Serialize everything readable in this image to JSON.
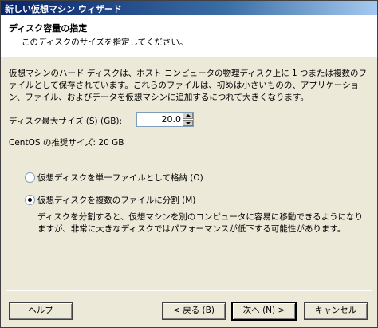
{
  "window": {
    "title": "新しい仮想マシン ウィザード"
  },
  "header": {
    "title": "ディスク容量の指定",
    "subtitle": "このディスクのサイズを指定してください。"
  },
  "description": "仮想マシンのハード ディスクは、ホスト コンピュータの物理ディスク上に 1 つまたは複数のファイルとして保存されています。これらのファイルは、初めは小さいものの、アプリケーション、ファイル、およびデータを仮想マシンに追加するにつれて大きくなります。",
  "disk_size": {
    "label": "ディスク最大サイズ (S) (GB):",
    "value": "20.0"
  },
  "recommended": "CentOS の推奨サイズ: 20 GB",
  "options": {
    "single_file_label": "仮想ディスクを単一ファイルとして格納 (O)",
    "single_file_selected": false,
    "split_label": "仮想ディスクを複数のファイルに分割 (M)",
    "split_selected": true,
    "split_description": "ディスクを分割すると、仮想マシンを別のコンピュータに容易に移動できるようになりますが、非常に大きなディスクではパフォーマンスが低下する可能性があります。"
  },
  "buttons": {
    "help": "ヘルプ",
    "back": "< 戻る (B)",
    "next": "次へ (N) >",
    "cancel": "キャンセル"
  },
  "colors": {
    "titlebar_start": "#0a246a",
    "dialog_bg": "#ece9d8",
    "header_bg": "#ffffff"
  }
}
